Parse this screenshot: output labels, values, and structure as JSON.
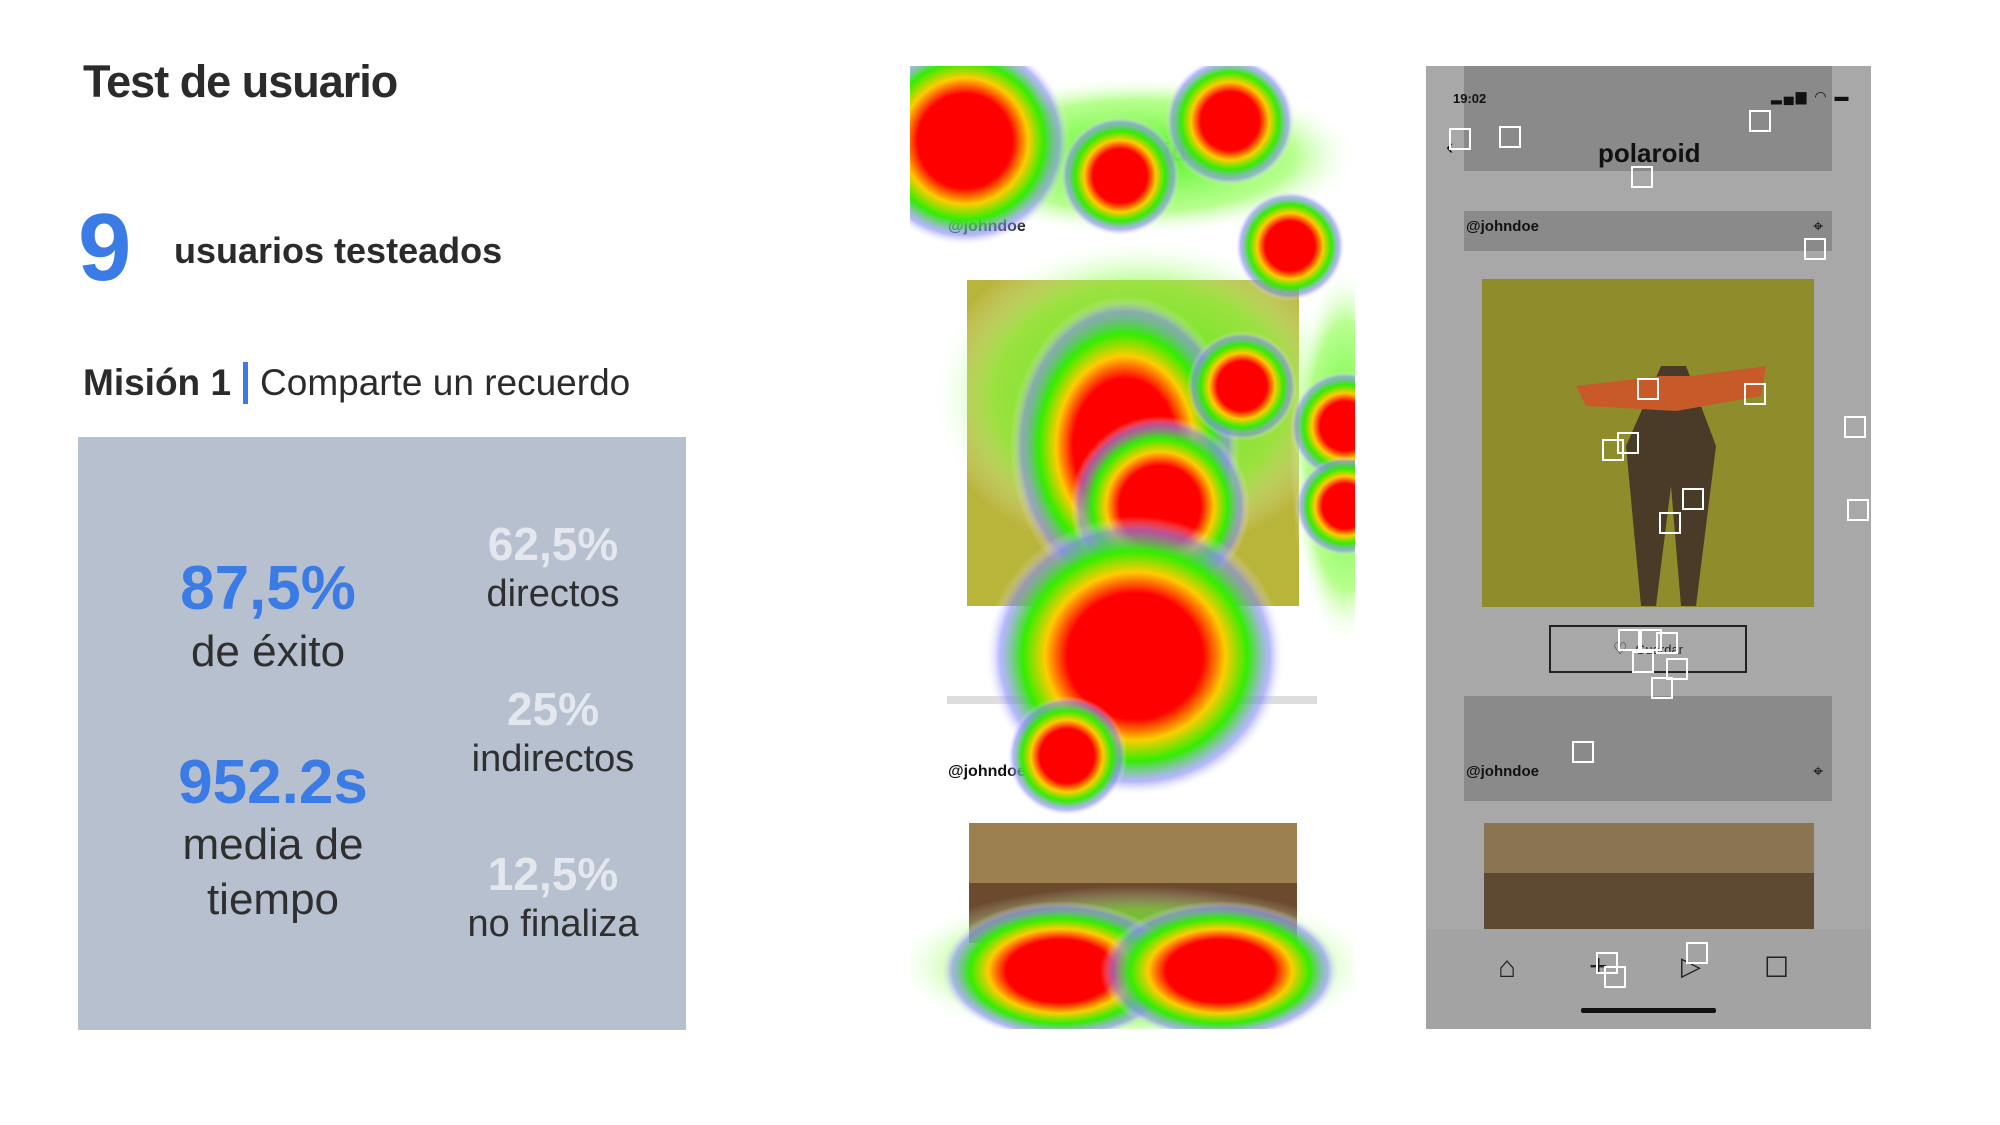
{
  "header": {
    "title": "Test de usuario"
  },
  "users": {
    "count": "9",
    "label": "usuarios testeados"
  },
  "mission": {
    "number": "Misión 1",
    "description": "Comparte un recuerdo"
  },
  "stats": {
    "success_value": "87,5%",
    "success_label": "de éxito",
    "time_value": "952.2s",
    "time_label_1": "media de",
    "time_label_2": "tiempo",
    "direct_value": "62,5%",
    "direct_label": "directos",
    "indirect_value": "25%",
    "indirect_label": "indirectos",
    "unfinished_value": "12,5%",
    "unfinished_label": "no finaliza"
  },
  "phone_screen": {
    "status_time": "19:02",
    "app_title": "polaroid",
    "post_username_1": "@johndoe",
    "post_username_2": "@johndoe",
    "save_button_label": "Guardar"
  },
  "colors": {
    "accent": "#3b7be6",
    "panel_bg": "#b7c0cf",
    "heat_hot": "#ff0000",
    "heat_mid": "#ffff00",
    "heat_cool": "#00ff00"
  },
  "icons": [
    "back-icon",
    "signal-icon",
    "wifi-icon",
    "battery-icon",
    "location-pin-icon",
    "heart-icon",
    "home-icon",
    "add-icon",
    "play-icon",
    "profile-icon"
  ]
}
